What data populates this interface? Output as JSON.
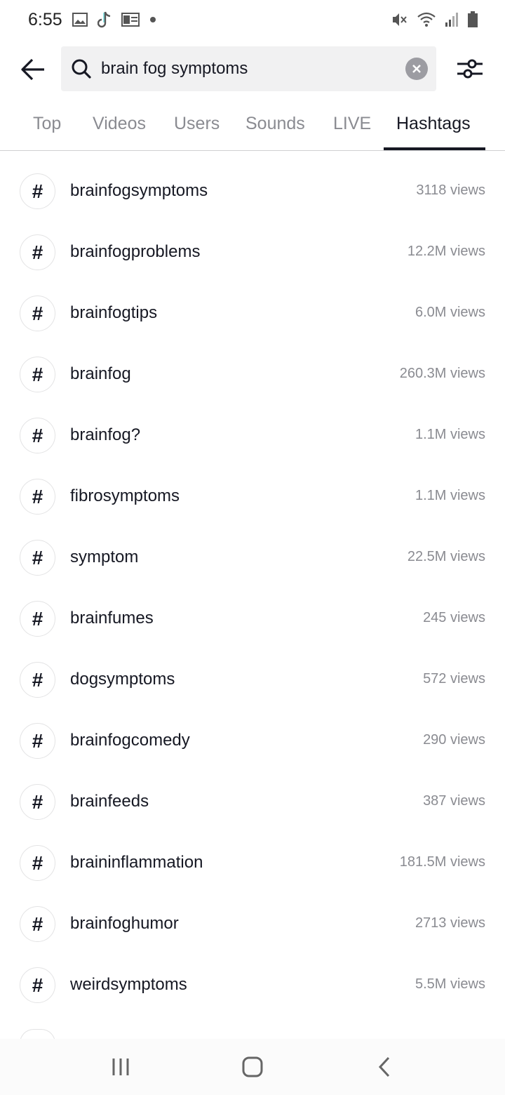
{
  "status_bar": {
    "time": "6:55",
    "left_icons": [
      "image-icon",
      "tiktok-icon",
      "outlook-icon",
      "dot-icon"
    ],
    "right_icons": [
      "mute-icon",
      "wifi-icon",
      "signal-icon",
      "battery-icon"
    ]
  },
  "search": {
    "query": "brain fog symptoms"
  },
  "tabs": [
    {
      "label": "Top",
      "active": false
    },
    {
      "label": "Videos",
      "active": false
    },
    {
      "label": "Users",
      "active": false
    },
    {
      "label": "Sounds",
      "active": false
    },
    {
      "label": "LIVE",
      "active": false
    },
    {
      "label": "Hashtags",
      "active": true
    }
  ],
  "hashtags": [
    {
      "symbol": "#",
      "name": "brainfogsymptoms",
      "views": "3118 views"
    },
    {
      "symbol": "#",
      "name": "brainfogproblems",
      "views": "12.2M views"
    },
    {
      "symbol": "#",
      "name": "brainfogtips",
      "views": "6.0M views"
    },
    {
      "symbol": "#",
      "name": "brainfog",
      "views": "260.3M views"
    },
    {
      "symbol": "#",
      "name": "brainfog?",
      "views": "1.1M views"
    },
    {
      "symbol": "#",
      "name": "fibrosymptoms",
      "views": "1.1M views"
    },
    {
      "symbol": "#",
      "name": "symptom",
      "views": "22.5M views"
    },
    {
      "symbol": "#",
      "name": "brainfumes",
      "views": "245 views"
    },
    {
      "symbol": "#",
      "name": "dogsymptoms",
      "views": "572 views"
    },
    {
      "symbol": "#",
      "name": "brainfogcomedy",
      "views": "290 views"
    },
    {
      "symbol": "#",
      "name": "brainfeeds",
      "views": "387 views"
    },
    {
      "symbol": "#",
      "name": "braininflammation",
      "views": "181.5M views"
    },
    {
      "symbol": "#",
      "name": "brainfoghumor",
      "views": "2713 views"
    },
    {
      "symbol": "#",
      "name": "weirdsymptoms",
      "views": "5.5M views"
    }
  ],
  "nav_bar": {
    "buttons": [
      "recent-apps-icon",
      "home-icon",
      "back-nav-icon"
    ]
  },
  "colors": {
    "primary_text": "#161823",
    "secondary_text": "#8a8b91",
    "search_bg": "#f1f1f2"
  }
}
